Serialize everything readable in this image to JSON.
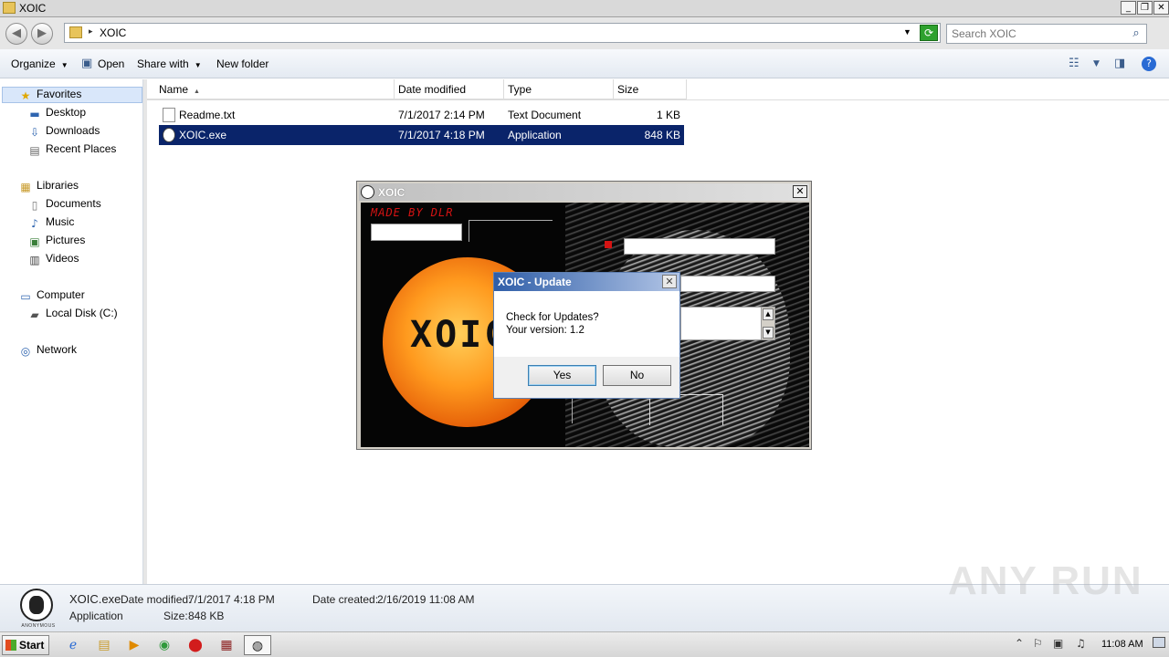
{
  "window": {
    "title": "XOIC"
  },
  "address": {
    "path": "XOIC",
    "search_placeholder": "Search XOIC"
  },
  "toolbar": {
    "organize": "Organize",
    "open": "Open",
    "share_with": "Share with",
    "new_folder": "New folder"
  },
  "nav": {
    "favorites": "Favorites",
    "desktop": "Desktop",
    "downloads": "Downloads",
    "recent_places": "Recent Places",
    "libraries": "Libraries",
    "documents": "Documents",
    "music": "Music",
    "pictures": "Pictures",
    "videos": "Videos",
    "computer": "Computer",
    "local_disk": "Local Disk (C:)",
    "network": "Network"
  },
  "columns": {
    "name": "Name",
    "date": "Date modified",
    "type": "Type",
    "size": "Size"
  },
  "files": [
    {
      "name": "Readme.txt",
      "date": "7/1/2017 2:14 PM",
      "type": "Text Document",
      "size": "1 KB"
    },
    {
      "name": "XOIC.exe",
      "date": "7/1/2017 4:18 PM",
      "type": "Application",
      "size": "848 KB"
    }
  ],
  "app": {
    "title": "XOIC",
    "made_by": "MADE BY DLR",
    "logo": "XOIC"
  },
  "dialog": {
    "title": "XOIC - Update",
    "line1": "Check for Updates?",
    "line2": "Your version: 1.2",
    "yes": "Yes",
    "no": "No"
  },
  "details": {
    "name": "XOIC.exe",
    "type": "Application",
    "modified_label": "Date modified:",
    "modified_value": "7/1/2017 4:18 PM",
    "created_label": "Date created:",
    "created_value": "2/16/2019 11:08 AM",
    "size_label": "Size:",
    "size_value": "848 KB",
    "thumb_caption": "ANONYMOUS"
  },
  "watermark": "ANY RUN",
  "taskbar": {
    "start": "Start",
    "clock": "11:08 AM"
  }
}
